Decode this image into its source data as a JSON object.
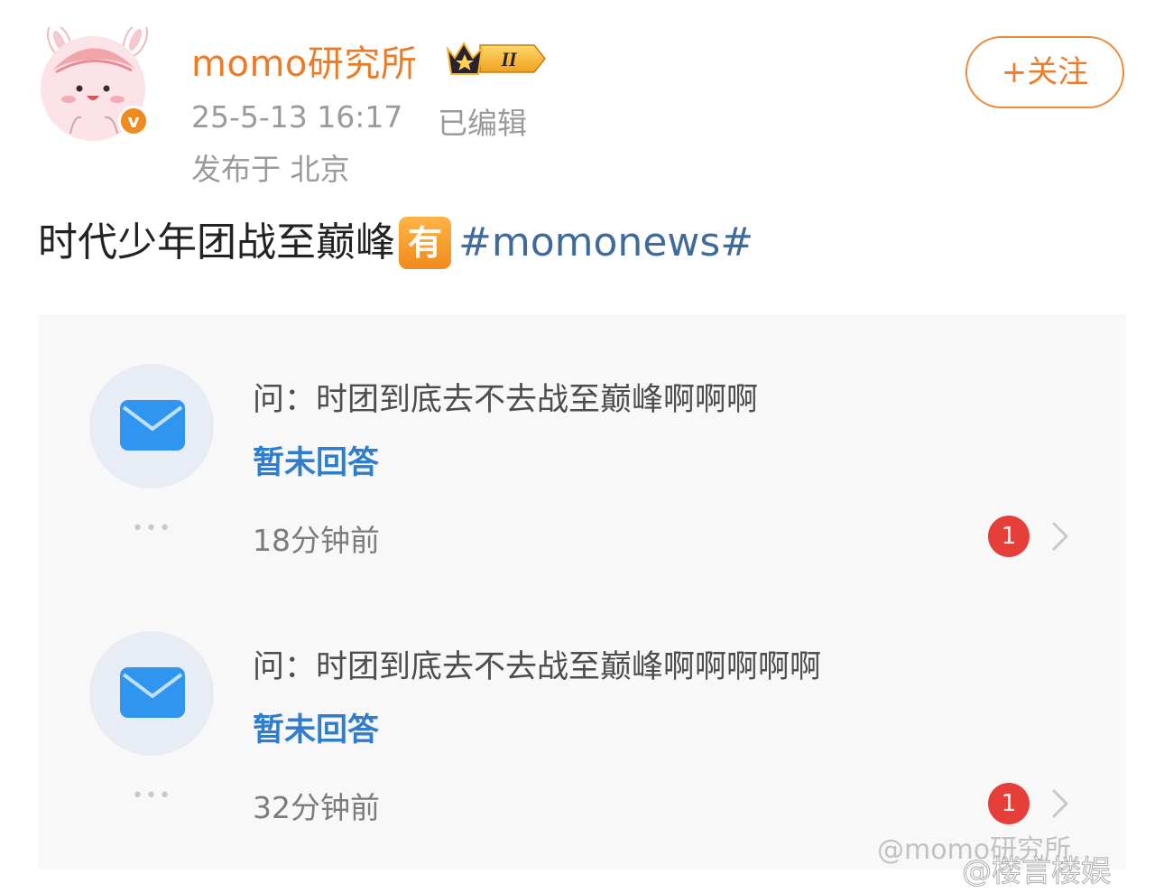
{
  "header": {
    "username": "momo研究所",
    "vip_level": "II",
    "verified_mark": "v",
    "timestamp": "25-5-13 16:17",
    "edited_label": "已编辑",
    "location": "发布于 北京",
    "follow_label": "+关注"
  },
  "post": {
    "text": "时代少年团战至巅峰",
    "emoji": "有",
    "hashtag": "#momonews#"
  },
  "qa_items": [
    {
      "question": "问：时团到底去不去战至巅峰啊啊啊",
      "status": "暂未回答",
      "time_ago": "18分钟前",
      "badge_count": "1",
      "more": "•••"
    },
    {
      "question": "问：时团到底去不去战至巅峰啊啊啊啊啊",
      "status": "暂未回答",
      "time_ago": "32分钟前",
      "badge_count": "1",
      "more": "•••"
    }
  ],
  "watermarks": {
    "primary": "@momo研究所",
    "secondary": "@楼言楼娱"
  },
  "colors": {
    "username": "#ed7a24",
    "follow_accent": "#ee7c2b",
    "hashtag": "#3f6a9c",
    "status_blue": "#2f7dcc",
    "badge_red": "#e63f3a"
  },
  "icons": {
    "avatar": "pink-bunny-avatar",
    "verified": "verified-v-icon",
    "vip": "crown-vip-icon",
    "mail": "envelope-icon",
    "chevron": "chevron-right-icon"
  }
}
